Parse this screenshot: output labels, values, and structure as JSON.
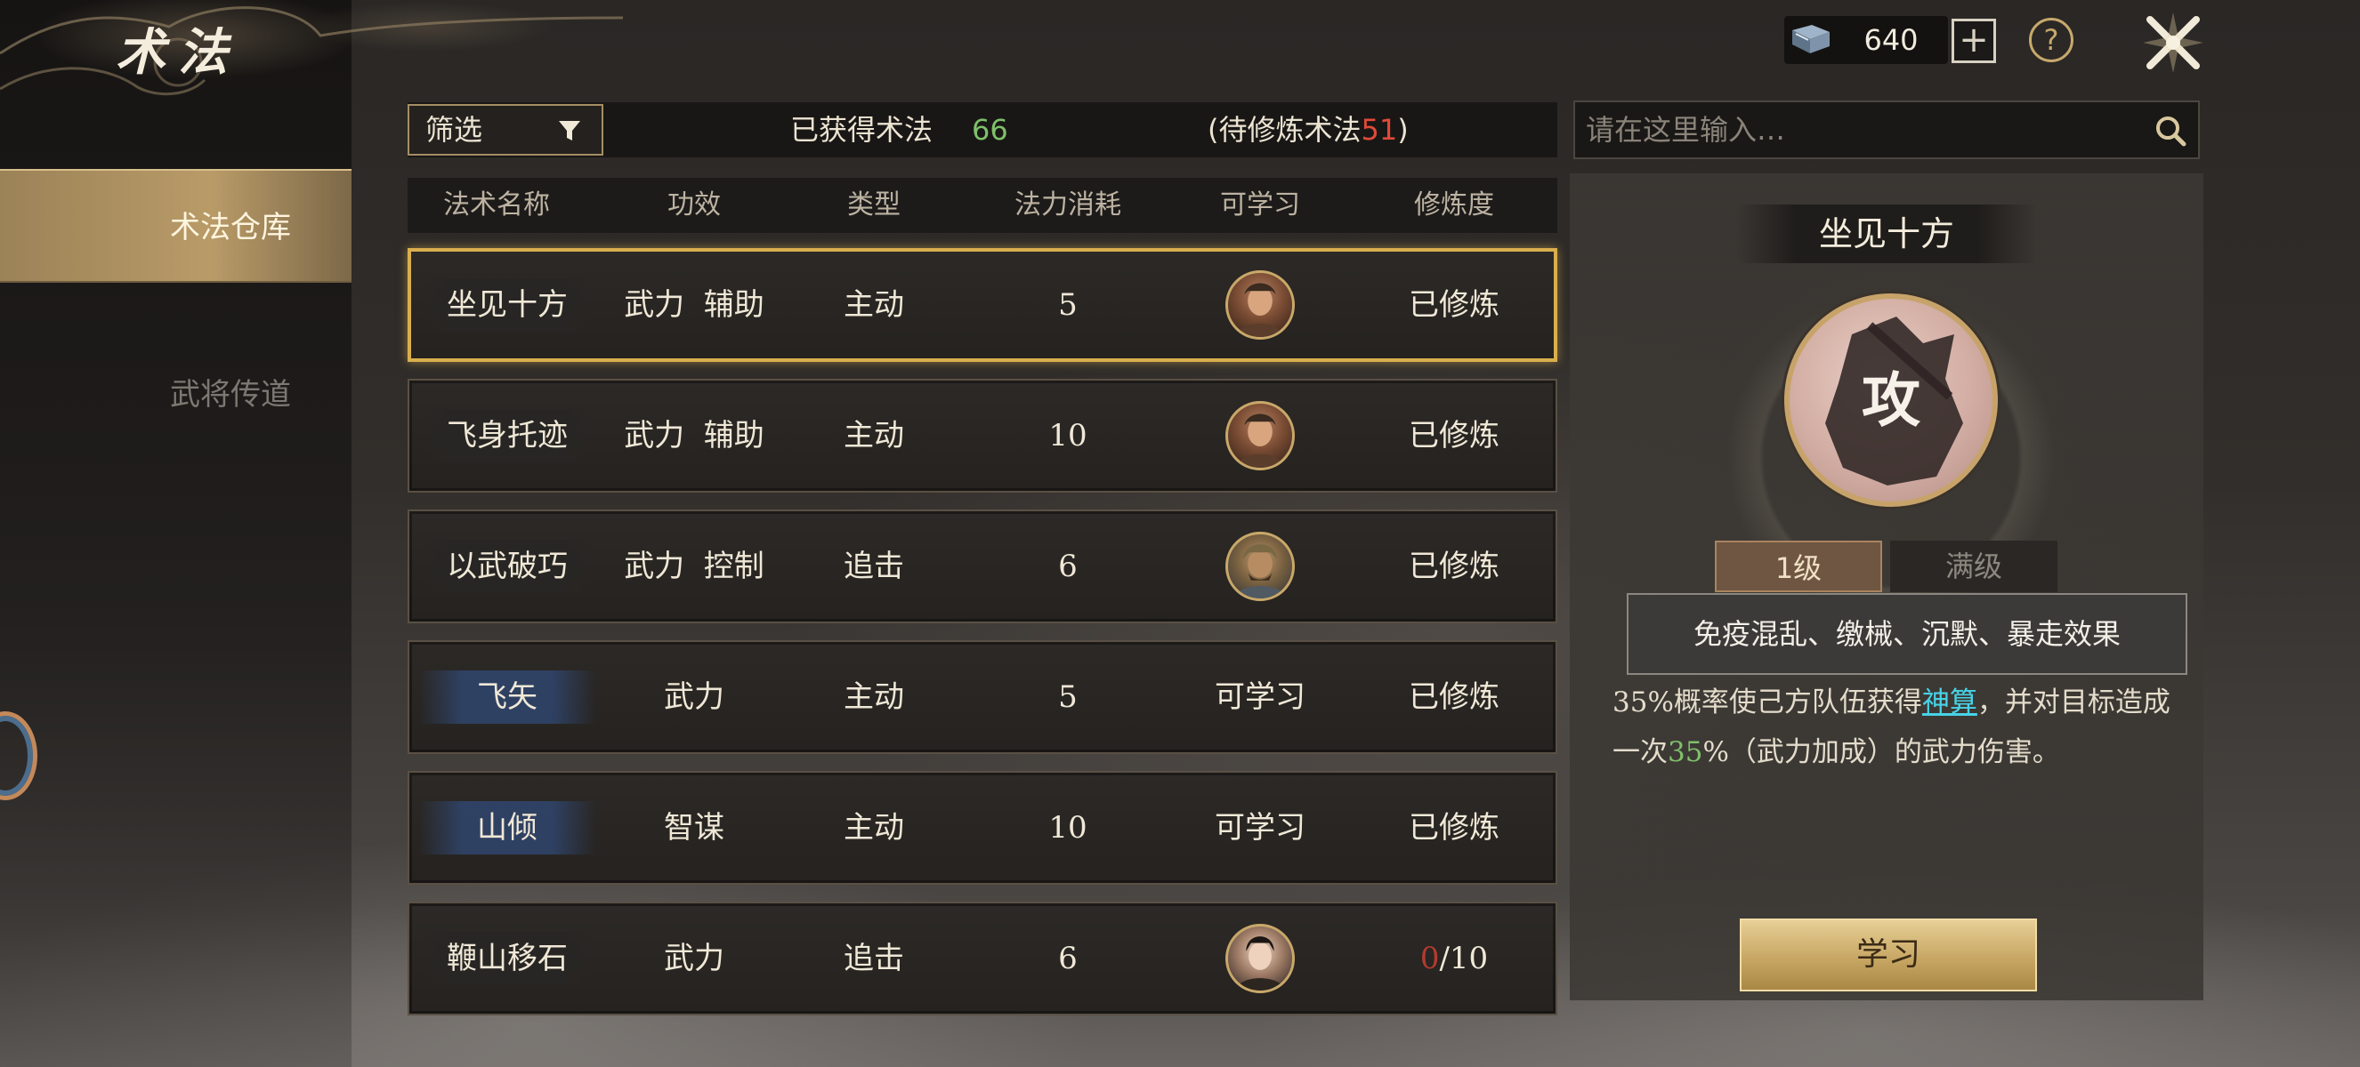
{
  "header": {
    "title": "术法",
    "resource_value": "640",
    "plus_label": "+",
    "help_label": "?"
  },
  "sidebar": {
    "items": [
      {
        "label": "术法仓库",
        "active": true
      },
      {
        "label": "武将传道",
        "active": false
      }
    ]
  },
  "filter": {
    "label": "筛选",
    "obtained_label": "已获得术法",
    "obtained_count": "66",
    "pending_prefix": "(待修炼术法",
    "pending_count": "51",
    "pending_suffix": ")"
  },
  "table": {
    "columns": [
      "法术名称",
      "功效",
      "类型",
      "法力消耗",
      "可学习",
      "修炼度"
    ],
    "rows": [
      {
        "name": "坐见十方",
        "effect": "武力  辅助",
        "type": "主动",
        "cost": "5",
        "learn": "avatar",
        "progress": "已修炼",
        "name_style": "dark",
        "avatar_style": "warm",
        "selected": true
      },
      {
        "name": "飞身托迹",
        "effect": "武力  辅助",
        "type": "主动",
        "cost": "10",
        "learn": "avatar",
        "progress": "已修炼",
        "name_style": "dark",
        "avatar_style": "warm"
      },
      {
        "name": "以武破巧",
        "effect": "武力  控制",
        "type": "追击",
        "cost": "6",
        "learn": "avatar",
        "progress": "已修炼",
        "name_style": "dark",
        "avatar_style": "bronze"
      },
      {
        "name": "飞矢",
        "effect": "武力",
        "type": "主动",
        "cost": "5",
        "learn": "可学习",
        "progress": "已修炼",
        "name_style": "blue"
      },
      {
        "name": "山倾",
        "effect": "智谋",
        "type": "主动",
        "cost": "10",
        "learn": "可学习",
        "progress": "已修炼",
        "name_style": "blue"
      },
      {
        "name": "鞭山移石",
        "effect": "武力",
        "type": "追击",
        "cost": "6",
        "learn": "avatar",
        "progress_current": "0",
        "progress_total": "/10",
        "name_style": "dark",
        "avatar_style": "pale"
      }
    ]
  },
  "search": {
    "placeholder": "请在这里输入…"
  },
  "detail": {
    "title": "坐见十方",
    "emblem_char": "攻",
    "level_tabs": [
      "1级",
      "满级"
    ],
    "tooltip": "免疫混乱、缴械、沉默、暴走效果",
    "desc_part1": "35%概率使己方队伍获得",
    "desc_link": "神算",
    "desc_part2": "，并对目标造成一次",
    "desc_green": "35",
    "desc_part3": "%（武力加成）的武力伤害。",
    "learn_button": "学习"
  },
  "colors": {
    "accent_gold": "#d9ae4d",
    "count_green": "#7fc06a",
    "count_red": "#e04a3a",
    "link_cyan": "#47d3e8"
  }
}
